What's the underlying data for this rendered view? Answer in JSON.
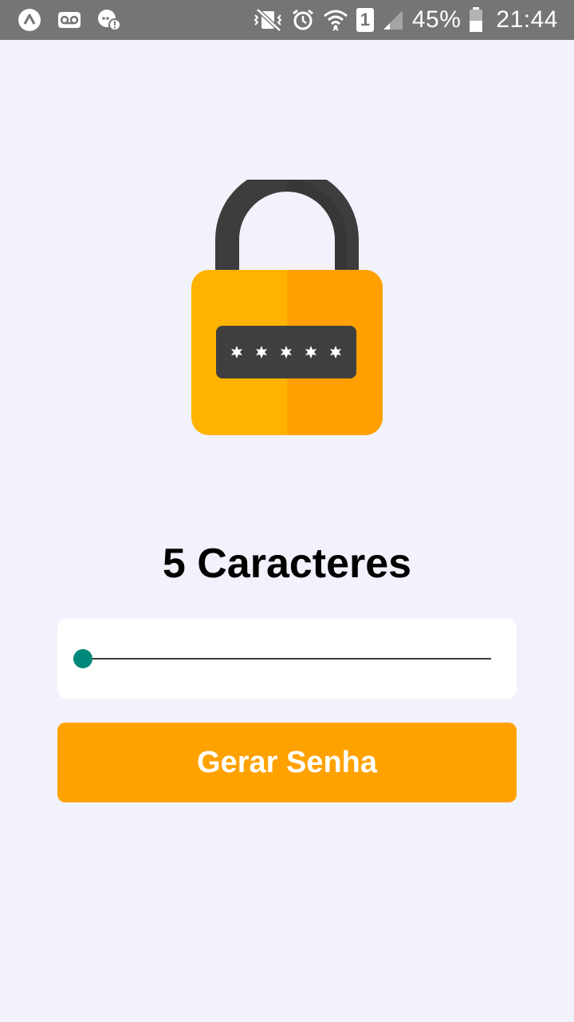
{
  "status_bar": {
    "battery_percent": "45%",
    "time": "21:44",
    "sim_slot": "1",
    "left_icons": [
      "app-a-icon",
      "voicemail-icon",
      "chat-alert-icon"
    ],
    "right_icons": [
      "vibrate-mute-icon",
      "alarm-icon",
      "wifi-icon",
      "sim-1-icon",
      "signal-icon",
      "battery-icon"
    ]
  },
  "lock_image": {
    "icon": "padlock-password-icon",
    "password_mask": "*****",
    "colors": {
      "body": "#ffb300",
      "body_shade": "#ffa000",
      "shackle": "#3d3d3d",
      "field": "#3f3f3f"
    }
  },
  "length_label": "5 Caracteres",
  "slider": {
    "value": 5,
    "min": 5,
    "max": 20,
    "fill_fraction": 0.0,
    "thumb_color": "#00897b"
  },
  "generate_button": {
    "label": "Gerar Senha",
    "color": "#ffa200"
  }
}
